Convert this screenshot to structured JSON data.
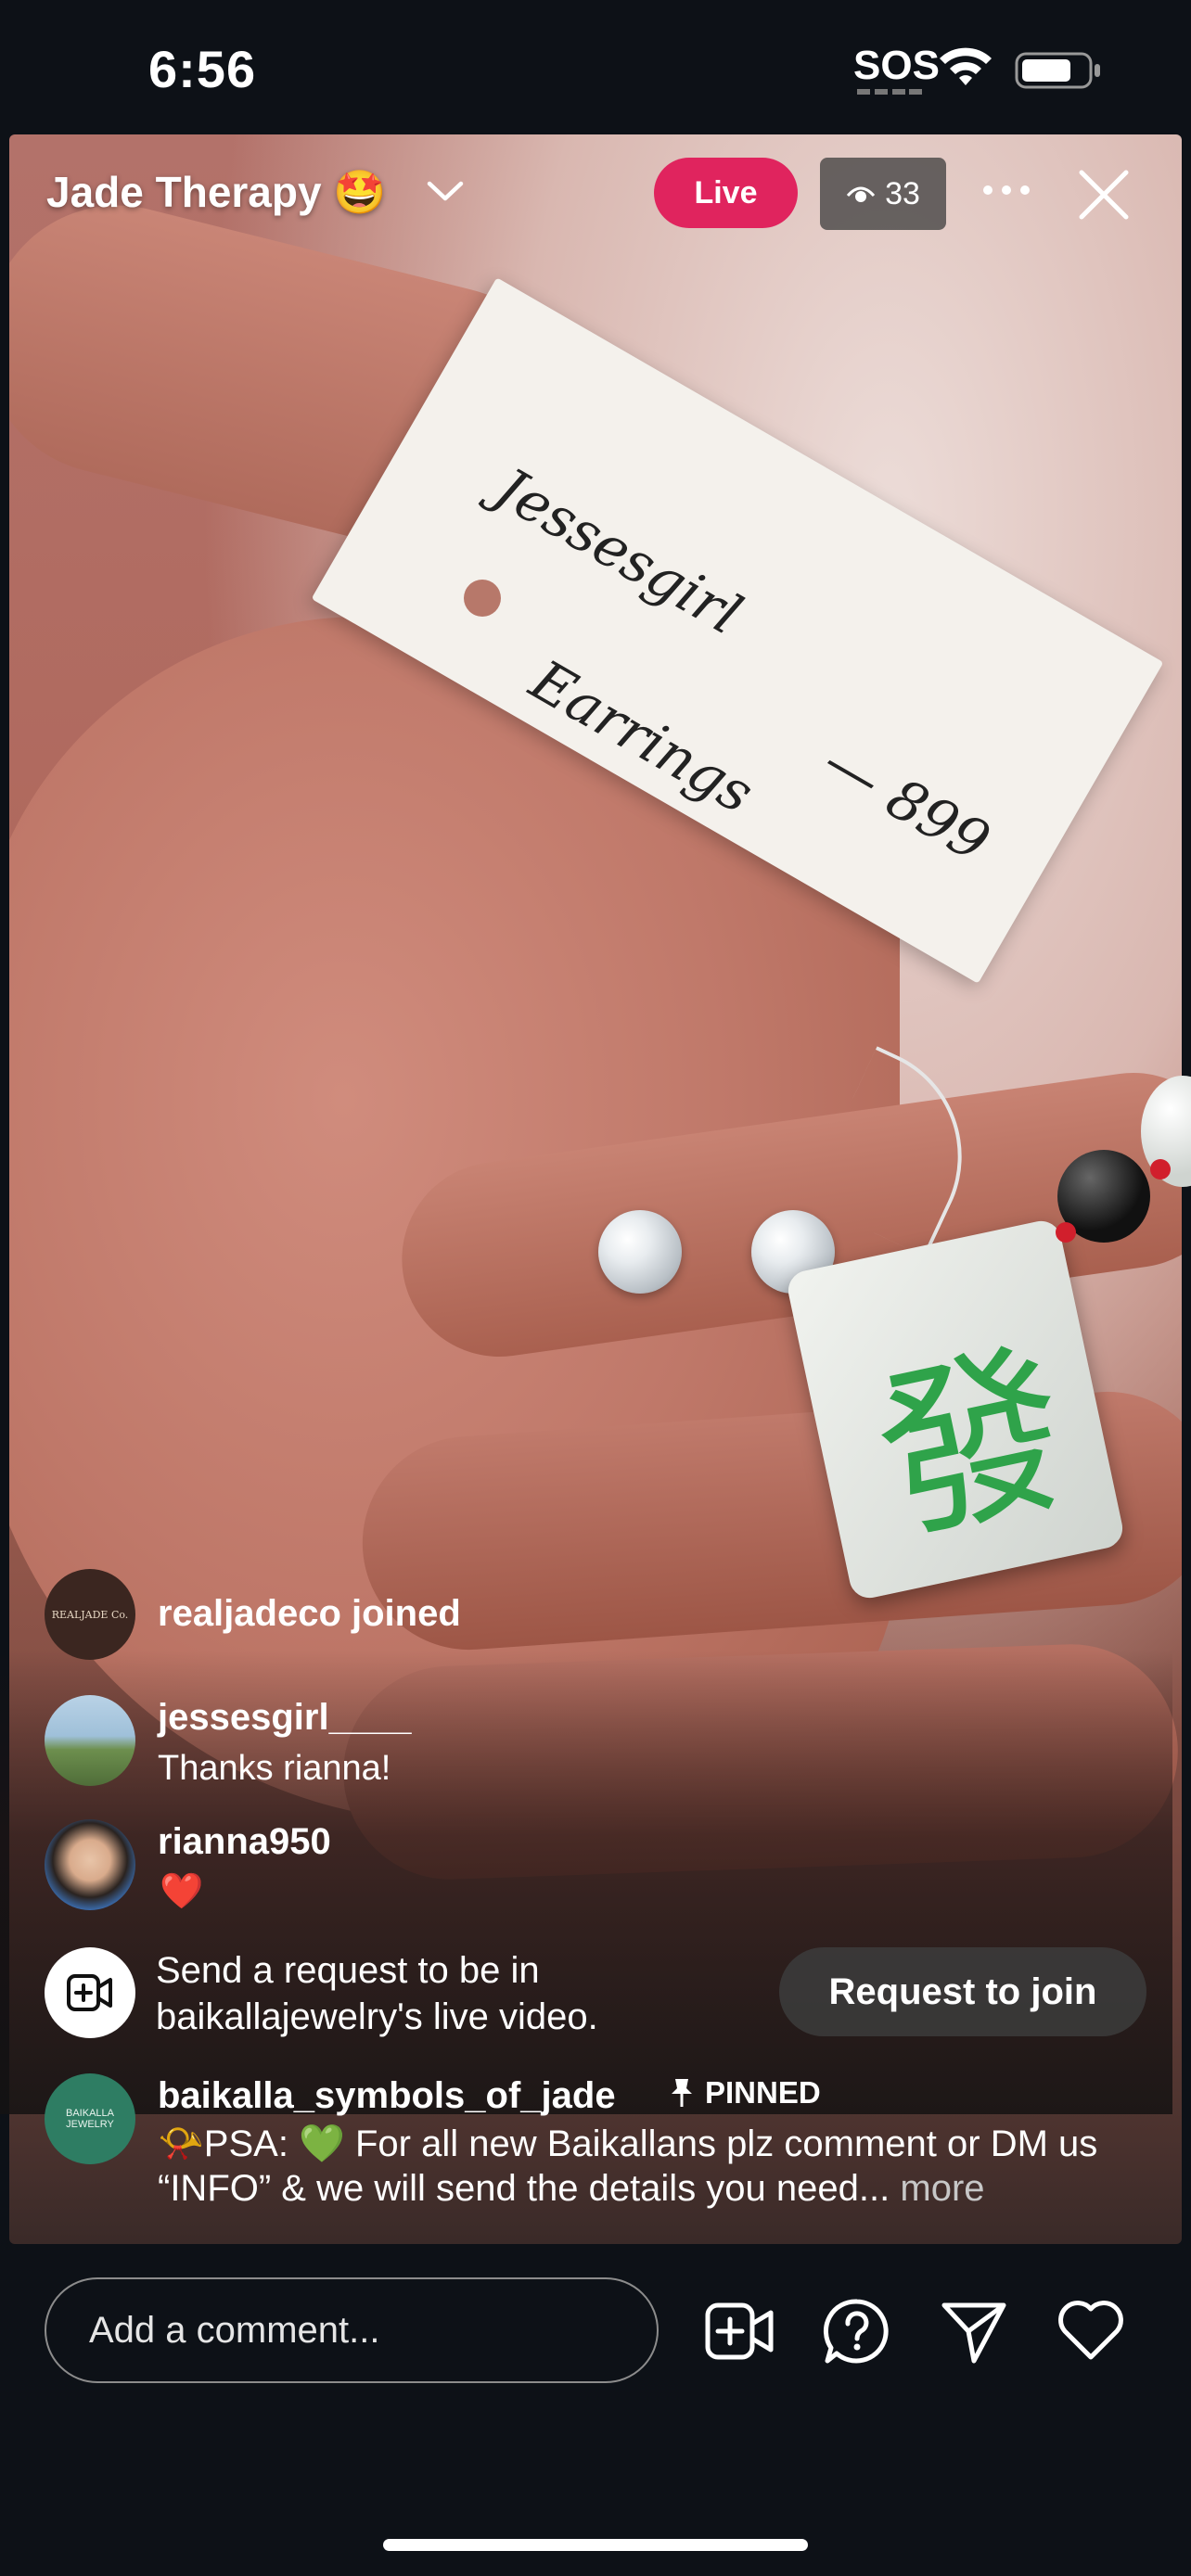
{
  "status_bar": {
    "time": "6:56",
    "sos": "SOS"
  },
  "header": {
    "channel_title": "Jade Therapy 🤩",
    "live_label": "Live",
    "viewer_count": "33"
  },
  "video": {
    "tag_line1": "Jessesgirl",
    "tag_line2": "Earrings",
    "tag_line3": "— 899",
    "tile_character": "發"
  },
  "comments": [
    {
      "username": "realjadeco joined",
      "avatar_text": "REALJADE Co."
    },
    {
      "username": "jessesgirl____",
      "text": "Thanks rianna!"
    },
    {
      "username": "rianna950",
      "text": "❤️"
    }
  ],
  "request": {
    "text": "Send a request to be in baikallajewelry's live video.",
    "button_label": "Request to join"
  },
  "pinned": {
    "username": "baikalla_symbols_of_jade",
    "badge": "PINNED",
    "avatar_text": "BAIKALLA JEWELRY",
    "text": "📯PSA: 💚 For all new Baikallans plz comment or DM us “INFO” & we will send the details you need...",
    "more_label": "more"
  },
  "bottom_bar": {
    "comment_placeholder": "Add a comment..."
  },
  "colors": {
    "live": "#e0245e",
    "background": "#0d1117"
  },
  "icons": [
    "wifi-icon",
    "battery-icon",
    "chevron-down-icon",
    "eye-icon",
    "more-icon",
    "close-icon",
    "video-request-icon",
    "pin-icon",
    "question-icon",
    "send-icon",
    "heart-icon"
  ]
}
